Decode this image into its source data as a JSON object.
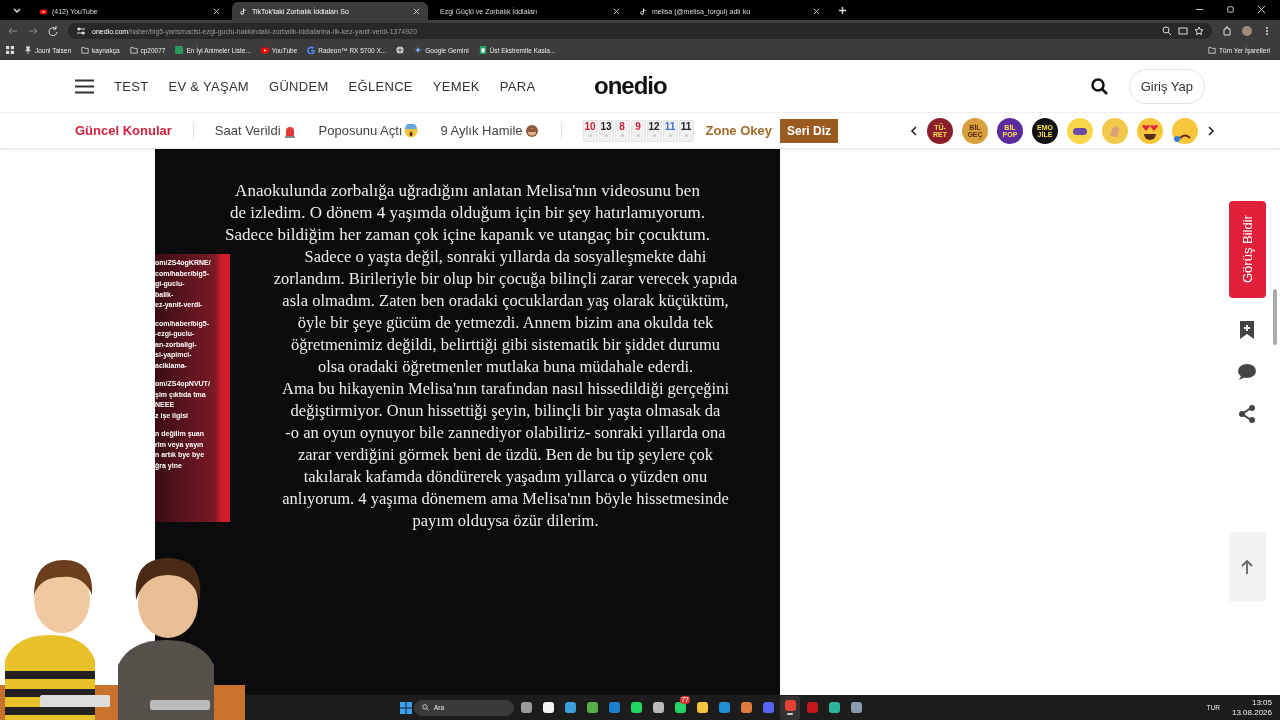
{
  "browser": {
    "tabs": [
      {
        "title": "(412) YouTube",
        "selected": false,
        "kind": "youtube"
      },
      {
        "title": "TikTok'taki Zorbalık İddiaları So",
        "selected": true,
        "kind": "tiktok"
      },
      {
        "title": "Ezgi Güçlü ve Zorbalık İddiaları",
        "selected": false
      },
      {
        "title": "melisa (@melisa_torgul) adlı ku",
        "selected": false,
        "kind": "tiktok"
      }
    ],
    "url_host": "onedio.com",
    "url_path": "/haber/big5-yarismacisi-ezgi-guclu-hakkindaki-zorbalik-iddialarina-ilk-kez-yanit-verdi-1374920",
    "bookmarks": [
      {
        "label": "Jouni Taisen",
        "kind": "pin"
      },
      {
        "label": "kaynakça",
        "kind": "folder"
      },
      {
        "label": "cp20077",
        "kind": "folder"
      },
      {
        "label": "En İyi Animeler Liste...",
        "kind": "app"
      },
      {
        "label": "YouTube",
        "kind": "youtube"
      },
      {
        "label": "Radeon™ RX 5700 X...",
        "kind": "g"
      },
      {
        "kind": "globe"
      },
      {
        "label": "Google Gemini",
        "kind": "gemini"
      },
      {
        "label": "Üst Ekstremite Kasla...",
        "kind": "sheet"
      }
    ],
    "all_bookmarks": "Tüm Yer İşaretleri"
  },
  "site": {
    "nav": [
      "TEST",
      "EV & YAŞAM",
      "GÜNDEM",
      "EĞLENCE",
      "YEMEK",
      "PARA"
    ],
    "logo": "onedio",
    "login": "Giriş Yap"
  },
  "trending": {
    "title": "Güncel Konular",
    "topics": [
      {
        "label": "Saat Verildi",
        "kind": "siren"
      },
      {
        "label": "Poposunu Açtı",
        "kind": "scream"
      },
      {
        "label": "9 Aylık Hamile",
        "kind": "monkey"
      }
    ],
    "counters": [
      {
        "value": "10",
        "color": "#d0213c"
      },
      {
        "value": "13",
        "color": "#222222"
      },
      {
        "value": "8",
        "color": "#d0213c"
      },
      {
        "value": "9",
        "color": "#d0213c"
      },
      {
        "value": "12",
        "color": "#222222"
      },
      {
        "value": "11",
        "color": "#3b6fd1"
      },
      {
        "value": "11",
        "color": "#222222"
      }
    ],
    "game": "Zone Okey",
    "game_button": "Seri Diz",
    "badges": [
      {
        "kind": "badge",
        "label": "TÜ-RET",
        "color": "#8a1f2a"
      },
      {
        "kind": "badge",
        "label": "BİL GEÇ",
        "color": "#d9a040"
      },
      {
        "kind": "badge",
        "label": "BİL POP",
        "color": "#5b2a9c"
      },
      {
        "kind": "badge",
        "label": "EMO JİLE",
        "color": "#111111"
      },
      {
        "kind": "gamepad",
        "color": "#f7d84a"
      },
      {
        "kind": "hand",
        "color": "#f2c84a"
      },
      {
        "kind": "love",
        "color": "#f8c63a"
      },
      {
        "kind": "sad",
        "color": "#f8c63a"
      }
    ]
  },
  "article_image": {
    "lines": [
      "Anaokulunda zorbalığa uğradığını anlatan Melisa'nın videosunu ben",
      "de izledim. O dönem 4 yaşımda olduğum için bir şey hatırlamıyorum.",
      "Sadece bildiğim her zaman çok içine kapanık ve utangaç bir çocuktum.",
      "Sadece o yaşta değil, sonraki yıllarda da sosyalleşmekte dahi",
      "zorlandım. Birileriyle bir olup bir çocuğa bilinçli zarar verecek yapıda",
      "asla olmadım. Zaten ben oradaki çocuklardan yaş olarak küçüktüm,",
      "öyle bir şeye gücüm de yetmezdi. Annem bizim ana okulda tek",
      "öğretmenimiz değildi, belirttiği gibi sistematik bir şiddet durumu",
      "olsa oradaki öğretmenler mutlaka buna müdahale ederdi.",
      "Ama bu hikayenin Melisa'nın tarafından nasıl hissedildiği gerçeğini",
      "değiştirmiyor. Onun hissettiği şeyin, bilinçli bir yaşta olmasak da",
      "-o an oyun oynuyor bile zannediyor olabiliriz- sonraki yıllarda ona",
      "zarar verdiğini görmek beni de üzdü. Ben de bu tip şeylere çok",
      "takılarak kafamda döndürerek yaşadım yıllarca o yüzden onu",
      "anlıyorum. 4 yaşıma dönemem ama Melisa'nın böyle hissetmesinde",
      "payım olduysa özür dilerim."
    ],
    "overlay_blocks": [
      {
        "lines": [
          "om/ZS4ogKRNE/",
          "com/haber/big5-",
          "gi-guclu-",
          "balik-",
          "ez-yanit-verdi-"
        ]
      },
      {
        "lines": [
          "com/haber/big5-",
          "-ezgi-guclu-",
          "an-zorbaligi-",
          "si-yapimci-",
          "aciklama-"
        ]
      },
      {
        "lines": [
          "om/ZS4opNVUT/",
          "şim çıktıda tma",
          "NEEE",
          "z işe ilgisi"
        ]
      },
      {
        "lines": [
          "n değilim şuan",
          "rim veya yayın",
          "n artık bye bye",
          "ğra yine"
        ]
      }
    ]
  },
  "side": {
    "feedback": "Görüş Bildir"
  },
  "taskbar": {
    "search": "Ara",
    "apps": [
      {
        "color": "#9a9a9a",
        "selected": false
      },
      {
        "color": "#f3f3f3",
        "selected": false
      },
      {
        "color": "#3aa0d8",
        "selected": false
      },
      {
        "color": "#55b04a",
        "selected": false
      },
      {
        "color": "#1a7fd0",
        "selected": false
      },
      {
        "color": "#1ed760",
        "selected": false
      },
      {
        "color": "#bbbbbb",
        "selected": false
      },
      {
        "color": "#25d366",
        "selected": false,
        "badge": "77"
      },
      {
        "color": "#f5c542",
        "selected": false
      },
      {
        "color": "#1e90d6",
        "selected": false
      },
      {
        "color": "#e07a3a",
        "selected": false
      },
      {
        "color": "#5865f2",
        "selected": false
      },
      {
        "color": "#e94235",
        "selected": true
      },
      {
        "color": "#c4161c",
        "selected": false
      },
      {
        "color": "#2bb59a",
        "selected": false
      },
      {
        "color": "#8a9bb0",
        "selected": false
      }
    ],
    "lang": "TUR",
    "time": "13:05",
    "date": "13.08.2026"
  }
}
